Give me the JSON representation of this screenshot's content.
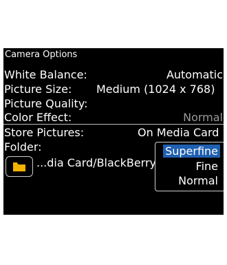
{
  "screen_title": "Camera Options",
  "settings": [
    {
      "label": "White Balance:",
      "value": "Automatic"
    },
    {
      "label": "Picture Size:",
      "value": "Medium (1024 x 768)"
    },
    {
      "label": "Picture Quality:",
      "value": ""
    },
    {
      "label": "Color Effect:",
      "value": "Normal"
    },
    {
      "label": "Store Pictures:",
      "value": "On Media Card"
    },
    {
      "label": "Folder:",
      "value": ""
    }
  ],
  "folder_path": "...dia Card/BlackBerry/pictures/",
  "quality_dropdown": {
    "options": [
      "Superfine",
      "Fine",
      "Normal"
    ],
    "selected": "Superfine"
  },
  "colors": {
    "background": "#000000",
    "selection": "#1f5fb0",
    "folder_icon": "#f2b200"
  }
}
